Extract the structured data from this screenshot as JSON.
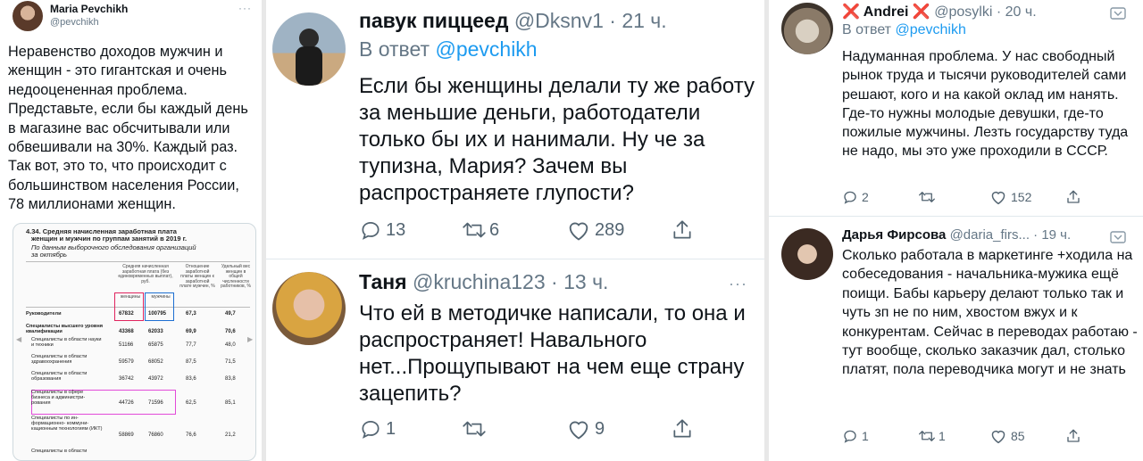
{
  "tweet1": {
    "name": "Maria Pevchikh",
    "handle": "@pevchikh",
    "more": "···",
    "text": "Неравенство доходов мужчин и женщин - это гигантская и очень недооцененная проблема. Представьте, если бы каждый день в магазине вас обсчитывали или обвешивали на 30%. Каждый раз. Так вот, это то, что происходит с большинством населения России, 78 миллионами женщин.",
    "table": {
      "title_line1": "4.34. Средняя начисленная заработная плата",
      "title_line2": "женщин и мужчин по группам занятий в 2019 г.",
      "subtitle_line1": "По данным выборочного обследования организаций",
      "subtitle_line2": "за октябрь",
      "head_salary": "Средняя начисленная заработная плата (без единовременных выплат), руб.",
      "head_ratio": "Отношение заработной платы женщин к заработной плате мужчин, %",
      "head_share": "Удельный вес женщин в общей численности работников, %",
      "head_women": "женщины",
      "head_men": "мужчины",
      "rows": [
        {
          "label": "Руководители",
          "women": "67832",
          "men": "100795",
          "ratio": "67,3",
          "share": "49,7"
        },
        {
          "label": "Специалисты высшего уровня квалификации",
          "women": "43368",
          "men": "62033",
          "ratio": "69,9",
          "share": "70,6"
        },
        {
          "label": "Специалисты в области науки и техники",
          "women": "51166",
          "men": "65875",
          "ratio": "77,7",
          "share": "48,0"
        },
        {
          "label": "Специалисты в области здравоохранения",
          "women": "59579",
          "men": "68052",
          "ratio": "87,5",
          "share": "71,5"
        },
        {
          "label": "Специалисты в области образования",
          "women": "36742",
          "men": "43972",
          "ratio": "83,6",
          "share": "83,8"
        },
        {
          "label": "Специалисты в сфере бизнеса и администри-рования",
          "women": "44726",
          "men": "71596",
          "ratio": "62,5",
          "share": "85,1"
        },
        {
          "label": "Специалисты по ин-формационно- коммуни-кационным технологиям (ИКТ)",
          "women": "58869",
          "men": "76860",
          "ratio": "76,6",
          "share": "21,2"
        },
        {
          "label": "Специалисты в области",
          "women": "",
          "men": "",
          "ratio": "",
          "share": ""
        }
      ]
    }
  },
  "tweet2": {
    "name": "павук пиццеед",
    "handle": "@Dksnv1",
    "time": "· 21 ч.",
    "reply_prefix": "В ответ",
    "reply_to": "@pevchikh",
    "text": "Если бы женщины делали ту же работу за меньшие деньги, работодатели только бы их и нанимали. Ну че за тупизна, Мария? Зачем вы распространяете глупости?",
    "replies": "13",
    "retweets": "6",
    "likes": "289"
  },
  "tweet3": {
    "name": "Таня",
    "handle": "@kruchina123",
    "time": "· 13 ч.",
    "more": "···",
    "text": "Что ей в методичке написали, то она и распространяет! Навального нет...Прощупывают на чем еще страну зацепить?",
    "replies": "1",
    "likes": "9"
  },
  "tweet4": {
    "name": "❌ Andrei ❌",
    "handle": "@posylki",
    "time": "· 20 ч.",
    "reply_prefix": "В ответ",
    "reply_to": "@pevchikh",
    "text": "Надуманная проблема. У нас свободный рынок труда и тысячи руководителей сами решают, кого и на какой оклад им нанять. Где-то нужны молодые девушки, где-то пожилые мужчины. Лезть государству туда не надо, мы это уже проходили в СССР.",
    "replies": "2",
    "likes": "152"
  },
  "tweet5": {
    "name": "Дарья Фирсова",
    "handle": "@daria_firs...",
    "time": "· 19 ч.",
    "text": "Сколько работала в маркетинге +ходила на собеседования - начальника-мужика ещё поищи. Бабы карьеру делают только так и чуть зп не по ним, хвостом вжух и к конкурентам. Сейчас в переводах работаю - тут вообще, сколько заказчик дал, столько платят, пола переводчика могут и не знать",
    "replies": "1",
    "retweets": "1",
    "likes": "85"
  },
  "colors": {
    "accent": "#1d9bf0",
    "muted": "#536471",
    "women_box": "#e0245e",
    "men_box": "#1d6fd1"
  }
}
